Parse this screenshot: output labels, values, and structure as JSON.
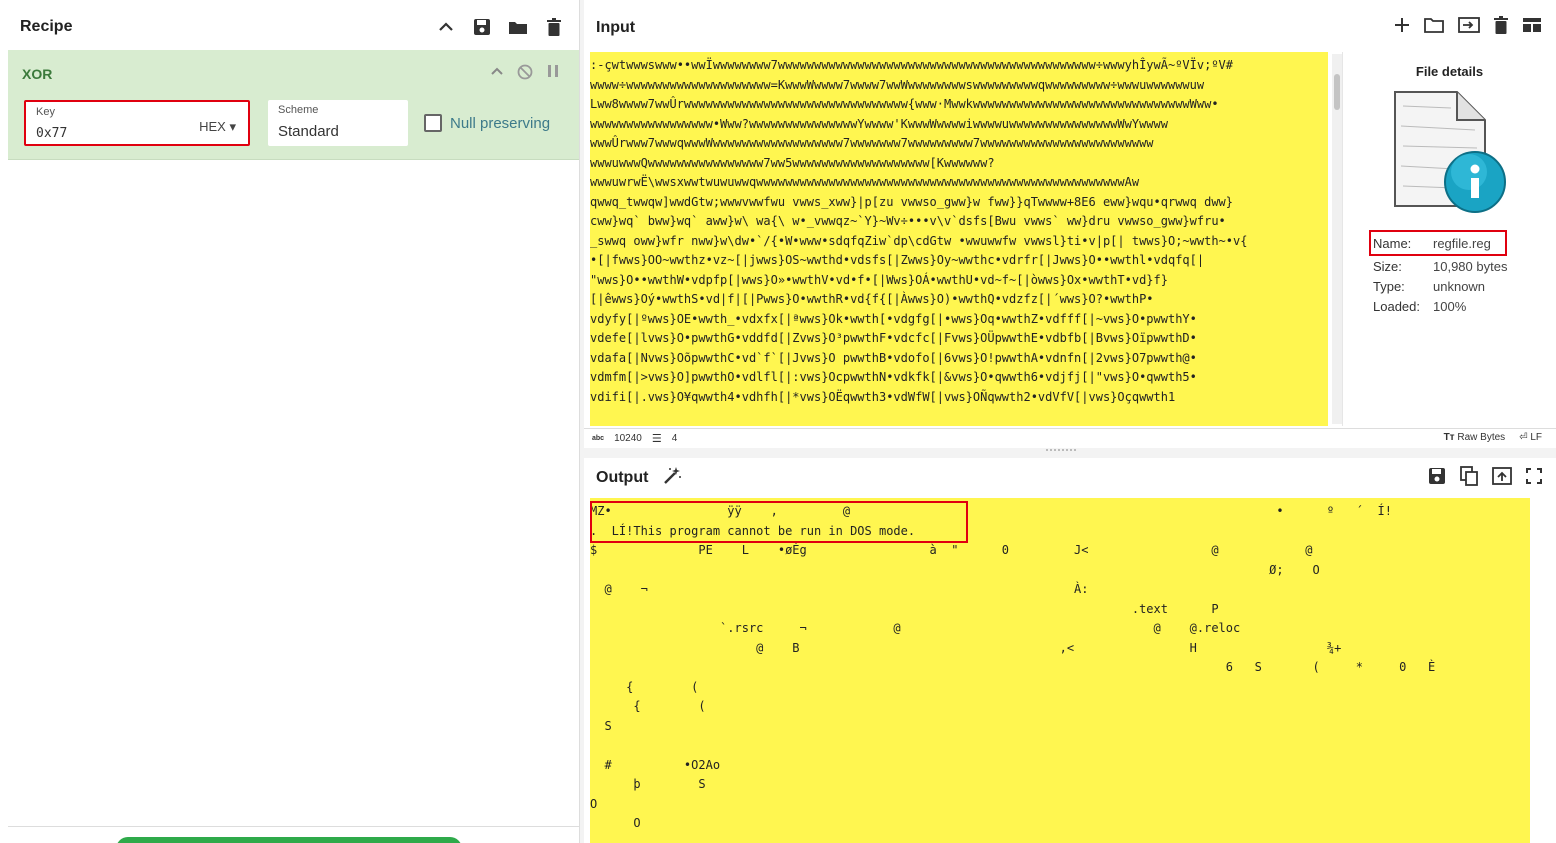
{
  "recipe": {
    "title": "Recipe",
    "operation": {
      "name": "XOR",
      "key_label": "Key",
      "key_value": "0x77",
      "key_format": "HEX",
      "scheme_label": "Scheme",
      "scheme_value": "Standard",
      "null_preserving_label": "Null preserving"
    }
  },
  "input": {
    "title": "Input",
    "lines": [
      ":-çwtwwwswww••wwÏwwwwwwww7wwwwwwwwwwwwwwwwwwwwwwwwwwwwwwwwwwwwwwwwwwww÷wwwyhÎywÃ~ºVÏv;ºV#",
      "wwww÷wwwwwwwwwwwwwwwwwwww=KwwwWwwww7wwww7wwWwwwwwwwwswwwwwwwwwqwwwwwwwww÷wwwuwwwwwwuw",
      "Lww8wwww7wwÛrwwwwwwwwwwwwwwwwwwwwwwwwwwwwwww{www·MwwkwwwwwwwwwwwwwwwwwwwwwwwwwwwwwwWww•",
      "wwwwwwwwwwwwwwwww•Www?wwwwwwwwwwwwwwwYwwww'KwwwWwwwwiwwwwuwwwwwwwwwwwwwwwWwYwwww",
      "wwwÛrwww7wwwqwwwWwwwwwwwwwwwwwwwwww7wwwwwww7wwwwwwwww7wwwwwwwwwwwwwwwwwwwwwwww",
      "wwwuwwwQwwwwwwwwwwwwwwww7ww5wwwwwwwwwwwwwwwwwww[Kwwwwww?",
      "wwwuwrwË\\wwsxwwtwuwuwwqwwwwwwwwwwwwwwwwwwwwwwwwwwwwwwwwwwwwwwwwwwwwwwwwwwwAw",
      "qwwq_twwqw]wwdGtw;wwwvwwfwu vwws_xww}|p[zu vwwso_gww}w fww}}qTwwww+8E6 eww}wqu•qrwwq dww}",
      "cww}wq` bww}wq` aww}w\\ wa{\\ w•_vwwqz~`Y}~Wv÷•••v\\v`dsfs[Bwu vwws` ww}dru vwwso_gww}wfru•",
      "_swwq oww}wfr nww}w\\dw•`/{•W•www•sdqfqZiw`dp\\cdGtw •wwuwwfw vwwsl}ti•v|p[| twws}O;~wwth~•v{",
      "•[|fwws}OO~wwthz•vz~[|jwws}OS~wwthd•vdsfs[|Zwws}Oy~wwthc•vdrfr[|Jwws}O••wwthl•vdqfq[|",
      "\"wws}O••wwthW•vdpfp[|wws}O»•wwthV•vd•f•[|Wws}OÁ•wwthU•vd~f~[|òwws}Ox•wwthT•vd}f}",
      "[|êwws}Oý•wwthS•vd|f|[|Pwws}O•wwthR•vd{f{[|Àwws}O)•wwthQ•vdzfz[|´wws}O?•wwthP•",
      "vdyfy[|ºwws}OE•wwth_•vdxfx[|ªwws}Ok•wwth[•vdgfg[|•wws}Oq•wwthZ•vdfff[|~vws}O•pwwthY•",
      "vdefe[|lvws}O•pwwthG•vddfd[|Zvws}O³pwwthF•vdcfc[|Fvws}OÜpwwthE•vdbfb[|Bvws}OïpwwthD•",
      "vdafa[|Nvws}OõpwwthC•vd`f`[|Jvws}O pwwthB•vdofo[|6vws}O!pwwthA•vdnfn[|2vws}O7pwwth@•",
      "vdmfm[|>vws}O]pwwthO•vdlfl[|:vws}OcpwwthN•vdkfk[|&vws}O•qwwth6•vdjfj[|\"vws}O•qwwth5•",
      "vdifi[|.vws}O¥qwwth4•vdhfh[|*vws}OËqwwth3•vdWfW[|vws}OÑqwwth2•vdVfV[|vws}Oçqwwth1"
    ],
    "status": {
      "length": "10240",
      "lines": "4",
      "encoding": "Raw Bytes",
      "eol": "LF"
    }
  },
  "file_details": {
    "title": "File details",
    "name_label": "Name:",
    "name_value": "regfile.reg",
    "size_label": "Size:",
    "size_value": "10,980 bytes",
    "type_label": "Type:",
    "type_value": "unknown",
    "loaded_label": "Loaded:",
    "loaded_value": "100%"
  },
  "output": {
    "title": "Output",
    "lines": [
      "MZ•                ÿÿ    ,         @                                                           •      º   ´  Í!",
      ".  LÍ!This program cannot be run in DOS mode.",
      "$              PE    L    •øÉg                 à  \"      0         J<                 @            @",
      "                                                                                              Ø;    O",
      "  @    ¬                                                           À:",
      "                                                                           .text      P",
      "                  `.rsrc     ¬            @                                   @    @.reloc",
      "                       @    B                                    ,<                H                  ¾+",
      "                                                                                        6   S       (     *     0   È",
      "     {        (",
      "      {        (",
      "  S",
      "",
      "  #          •O2Ao",
      "      þ        S",
      "O",
      "      O"
    ]
  },
  "colors": {
    "highlight": "#fff650",
    "accent_red": "#e0000f",
    "op_bg": "#d8ecd0",
    "op_title": "#3b7a3b",
    "bake_green": "#2eaa4a"
  }
}
